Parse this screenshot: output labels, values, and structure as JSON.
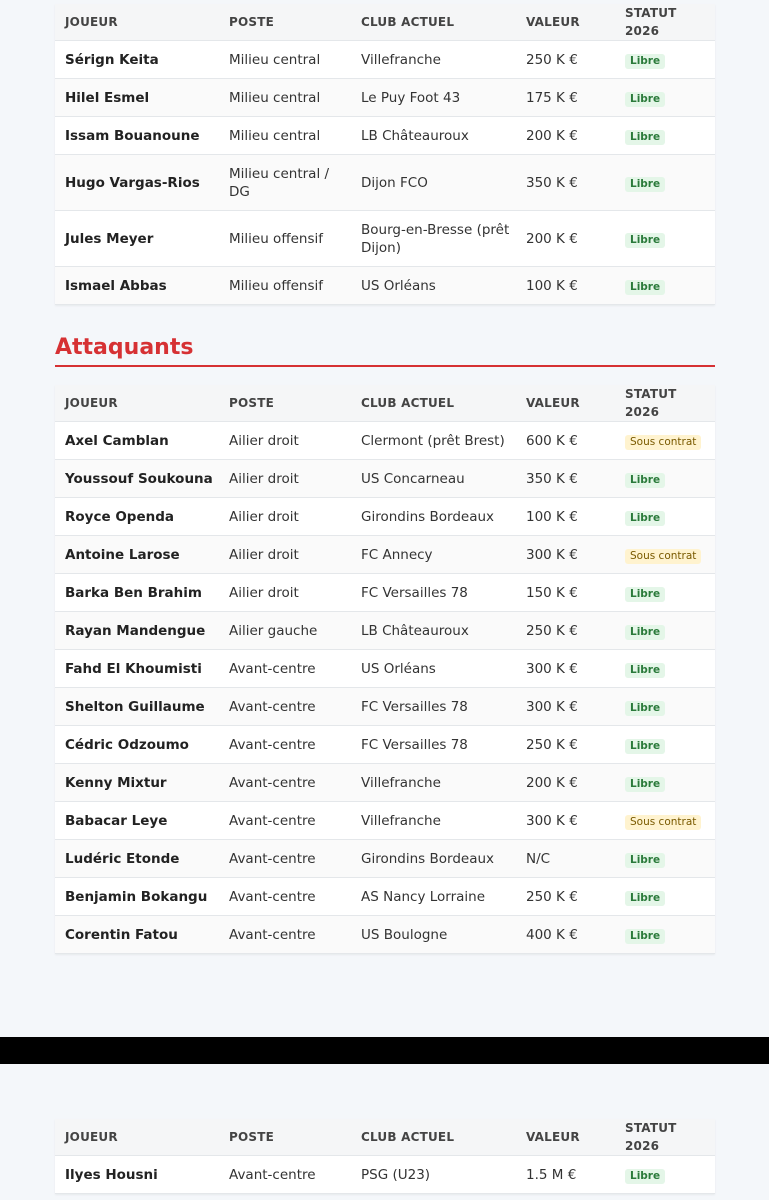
{
  "columns": [
    "JOUEUR",
    "POSTE",
    "CLUB ACTUEL",
    "VALEUR",
    "STATUT 2026"
  ],
  "milieux": [
    {
      "name": "Sérign Keita",
      "poste": "Milieu central",
      "club": "Villefranche",
      "valeur": "250 K €",
      "statut": "Libre"
    },
    {
      "name": "Hilel Esmel",
      "poste": "Milieu central",
      "club": "Le Puy Foot 43",
      "valeur": "175 K €",
      "statut": "Libre"
    },
    {
      "name": "Issam Bouanoune",
      "poste": "Milieu central",
      "club": "LB Châteauroux",
      "valeur": "200 K €",
      "statut": "Libre"
    },
    {
      "name": "Hugo Vargas-Rios",
      "poste": "Milieu central / DG",
      "club": "Dijon FCO",
      "valeur": "350 K €",
      "statut": "Libre"
    },
    {
      "name": "Jules Meyer",
      "poste": "Milieu offensif",
      "club": "Bourg-en-Bresse (prêt Dijon)",
      "valeur": "200 K €",
      "statut": "Libre"
    },
    {
      "name": "Ismael Abbas",
      "poste": "Milieu offensif",
      "club": "US Orléans",
      "valeur": "100 K €",
      "statut": "Libre"
    }
  ],
  "attaquants_title": "Attaquants",
  "attaquants": [
    {
      "name": "Axel Camblan",
      "poste": "Ailier droit",
      "club": "Clermont (prêt Brest)",
      "valeur": "600 K €",
      "statut": "Sous contrat"
    },
    {
      "name": "Youssouf Soukouna",
      "poste": "Ailier droit",
      "club": "US Concarneau",
      "valeur": "350 K €",
      "statut": "Libre"
    },
    {
      "name": "Royce Openda",
      "poste": "Ailier droit",
      "club": "Girondins Bordeaux",
      "valeur": "100 K €",
      "statut": "Libre"
    },
    {
      "name": "Antoine Larose",
      "poste": "Ailier droit",
      "club": "FC Annecy",
      "valeur": "300 K €",
      "statut": "Sous contrat"
    },
    {
      "name": "Barka Ben Brahim",
      "poste": "Ailier droit",
      "club": "FC Versailles 78",
      "valeur": "150 K €",
      "statut": "Libre"
    },
    {
      "name": "Rayan Mandengue",
      "poste": "Ailier gauche",
      "club": "LB Châteauroux",
      "valeur": "250 K €",
      "statut": "Libre"
    },
    {
      "name": "Fahd El Khoumisti",
      "poste": "Avant-centre",
      "club": "US Orléans",
      "valeur": "300 K €",
      "statut": "Libre"
    },
    {
      "name": "Shelton Guillaume",
      "poste": "Avant-centre",
      "club": "FC Versailles 78",
      "valeur": "300 K €",
      "statut": "Libre"
    },
    {
      "name": "Cédric Odzoumo",
      "poste": "Avant-centre",
      "club": "FC Versailles 78",
      "valeur": "250 K €",
      "statut": "Libre"
    },
    {
      "name": "Kenny Mixtur",
      "poste": "Avant-centre",
      "club": "Villefranche",
      "valeur": "200 K €",
      "statut": "Libre"
    },
    {
      "name": "Babacar Leye",
      "poste": "Avant-centre",
      "club": "Villefranche",
      "valeur": "300 K €",
      "statut": "Sous contrat"
    },
    {
      "name": "Ludéric Etonde",
      "poste": "Avant-centre",
      "club": "Girondins Bordeaux",
      "valeur": "N/C",
      "statut": "Libre"
    },
    {
      "name": "Benjamin Bokangu",
      "poste": "Avant-centre",
      "club": "AS Nancy Lorraine",
      "valeur": "250 K €",
      "statut": "Libre"
    },
    {
      "name": "Corentin Fatou",
      "poste": "Avant-centre",
      "club": "US Boulogne",
      "valeur": "400 K €",
      "statut": "Libre"
    }
  ],
  "bas": [
    {
      "name": "Ilyes Housni",
      "poste": "Avant-centre",
      "club": "PSG (U23)",
      "valeur": "1.5 M €",
      "statut": "Libre"
    }
  ],
  "colors": {
    "accent": "#d63133",
    "libre_bg": "#e4f6e8",
    "libre_fg": "#2a7a3a",
    "contrat_bg": "#fff3cf",
    "contrat_fg": "#7a5a00"
  }
}
